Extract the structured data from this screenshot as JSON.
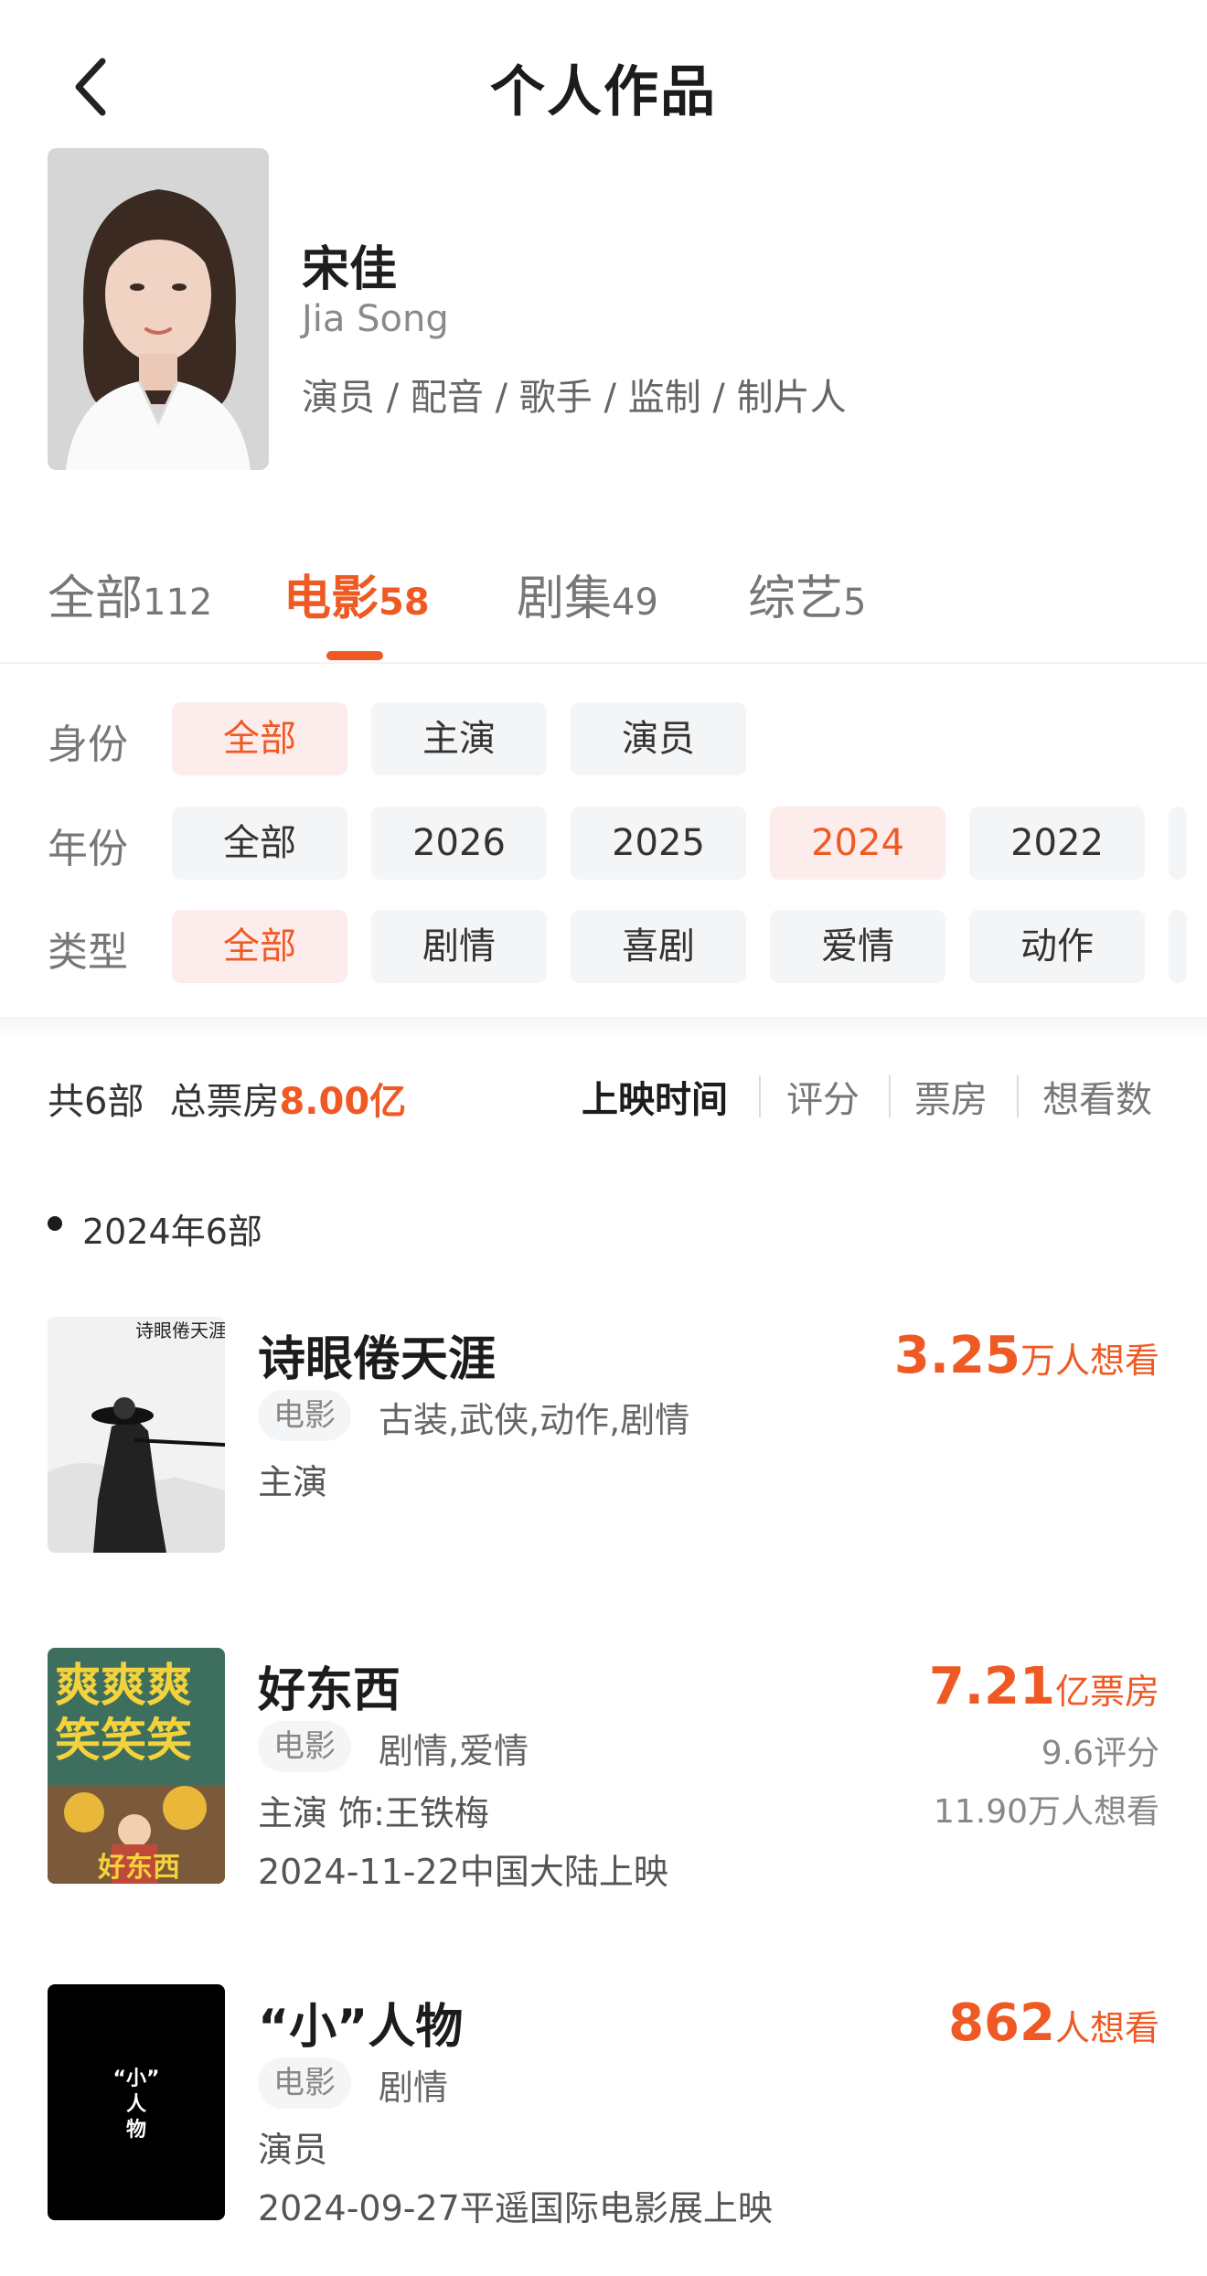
{
  "header": {
    "title": "个人作品",
    "back_icon": "chevron-left-icon"
  },
  "profile": {
    "name": "宋佳",
    "name_en": "Jia Song",
    "roles": "演员 / 配音 / 歌手 / 监制 / 制片人"
  },
  "tabs": [
    {
      "label": "全部",
      "count": "112",
      "active": false
    },
    {
      "label": "电影",
      "count": "58",
      "active": true
    },
    {
      "label": "剧集",
      "count": "49",
      "active": false
    },
    {
      "label": "综艺",
      "count": "5",
      "active": false
    }
  ],
  "filters": {
    "identity": {
      "label": "身份",
      "options": [
        "全部",
        "主演",
        "演员"
      ],
      "selected": "全部"
    },
    "year": {
      "label": "年份",
      "options": [
        "全部",
        "2026",
        "2025",
        "2024",
        "2022"
      ],
      "selected": "2024"
    },
    "genre": {
      "label": "类型",
      "options": [
        "全部",
        "剧情",
        "喜剧",
        "爱情",
        "动作"
      ],
      "selected": "全部"
    }
  },
  "summary": {
    "total": "共6部",
    "box_office_label": "总票房",
    "box_office_value": "8.00亿"
  },
  "sort": {
    "options": [
      "上映时间",
      "评分",
      "票房",
      "想看数"
    ],
    "active": "上映时间"
  },
  "year_group": {
    "heading": "2024年6部"
  },
  "movies": [
    {
      "title": "诗眼倦天涯",
      "tag": "电影",
      "genres": "古装,武侠,动作,剧情",
      "role": "主演",
      "release": "",
      "stat_value": "3.25",
      "stat_unit": "万人想看",
      "rating": "",
      "want": "",
      "poster_text": "诗眼倦天涯"
    },
    {
      "title": "好东西",
      "tag": "电影",
      "genres": "剧情,爱情",
      "role": "主演 饰:王铁梅",
      "release": "2024-11-22中国大陆上映",
      "stat_value": "7.21",
      "stat_unit": "亿票房",
      "rating": "9.6评分",
      "want": "11.90万人想看",
      "poster_text": "爽爽爽笑笑笑"
    },
    {
      "title": "“小”人物",
      "tag": "电影",
      "genres": "剧情",
      "role": "演员",
      "release": "2024-09-27平遥国际电影展上映",
      "stat_value": "862",
      "stat_unit": "人想看",
      "rating": "",
      "want": "",
      "poster_text": "“小”人物"
    }
  ],
  "colors": {
    "accent": "#ef5a24",
    "chip_bg": "#f3f5f7",
    "chip_selected_bg": "#fdecec"
  }
}
